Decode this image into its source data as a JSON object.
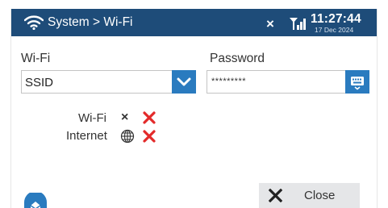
{
  "statusbar": {
    "wifi_icon": "wifi-icon",
    "title": "System > Wi-Fi",
    "x_glyph": "×",
    "signal_icon": "signal-icon",
    "time": "11:27:44",
    "date": "17 Dec 2024",
    "background": "#1e4c79"
  },
  "wifi": {
    "label": "Wi-Fi",
    "ssid_value": "SSID",
    "dropdown_icon": "chevron-down-icon"
  },
  "password": {
    "label": "Password",
    "value": "*********",
    "keyboard_icon": "keyboard-icon"
  },
  "status": {
    "wifi_label": "Wi-Fi",
    "wifi_glyph": "×",
    "internet_label": "Internet",
    "globe_icon": "globe-icon",
    "error_icon": "red-x-icon",
    "error_color": "#e32a2a"
  },
  "footer": {
    "menu_icon": "home-tab-icon",
    "close_label": "Close",
    "close_icon": "close-icon"
  },
  "colors": {
    "accent": "#2a7bbf",
    "statusbar": "#1e4c79",
    "button_bg": "#e5e6e8"
  }
}
